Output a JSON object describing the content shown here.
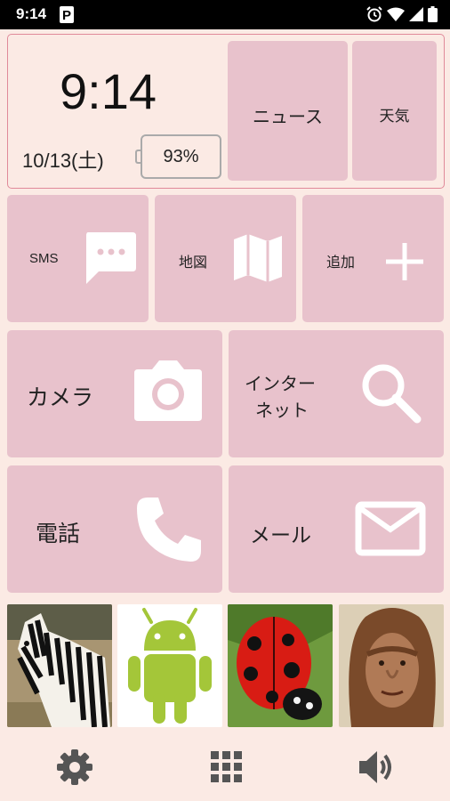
{
  "status_bar": {
    "time": "9:14",
    "app_indicator": "P",
    "icons": [
      "alarm-icon",
      "wifi-icon",
      "signal-icon",
      "battery-icon"
    ]
  },
  "clock": {
    "time": "9:14",
    "date": "10/13(土)",
    "battery": "93%"
  },
  "tiles": {
    "news": "ニュース",
    "weather": "天気",
    "sms": "SMS",
    "map": "地図",
    "add": "追加",
    "camera": "カメラ",
    "internet_line1": "インター",
    "internet_line2": "ネット",
    "phone": "電話",
    "mail": "メール"
  },
  "photos": [
    "zebra",
    "android",
    "ladybug",
    "early-human"
  ],
  "bottom_bar": [
    "settings-icon",
    "apps-grid-icon",
    "volume-icon"
  ],
  "colors": {
    "tile": "#e8c2cc",
    "background": "#fbeae4",
    "border": "#e08a9a",
    "icon": "#ffffff"
  }
}
